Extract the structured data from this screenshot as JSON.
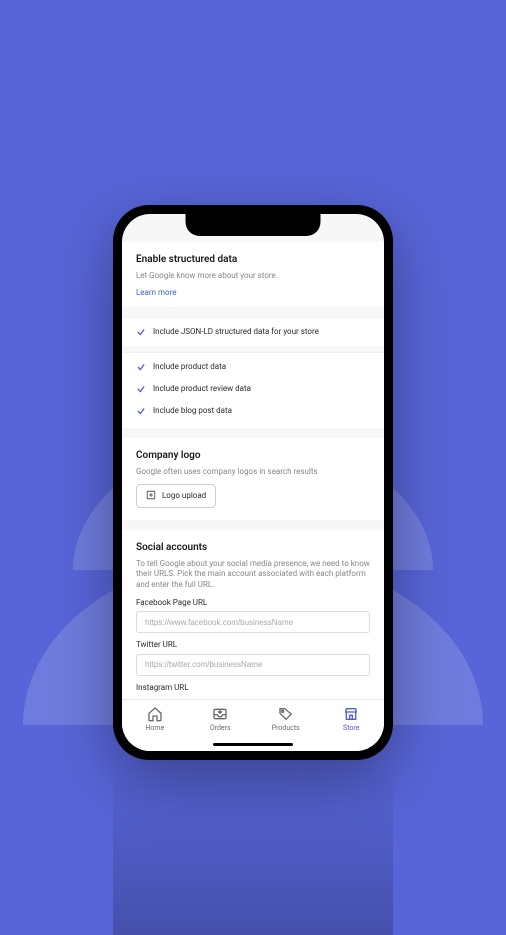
{
  "section1": {
    "title": "Enable structured data",
    "desc": "Let Google know more about your store.",
    "learn": "Learn more",
    "chk_main": "Include JSON-LD structured data for your store",
    "chk_a": "Include product data",
    "chk_b": "Include product review data",
    "chk_c": "Include blog post data"
  },
  "section2": {
    "title": "Company logo",
    "desc": "Google often uses company logos in search results",
    "upload_label": "Logo upload"
  },
  "section3": {
    "title": "Social accounts",
    "desc": "To tell Google about your social media presence, we need to know their URLS. Pick the main account associated with each platform and enter the full URL.",
    "fb_label": "Facebook Page URL",
    "fb_placeholder": "https://www.facebook.com/businessName",
    "tw_label": "Twitter URL",
    "tw_placeholder": "https://twitter.com/businessName",
    "ig_label": "Instagram URL"
  },
  "tabs": {
    "home": "Home",
    "orders": "Orders",
    "products": "Products",
    "store": "Store"
  }
}
